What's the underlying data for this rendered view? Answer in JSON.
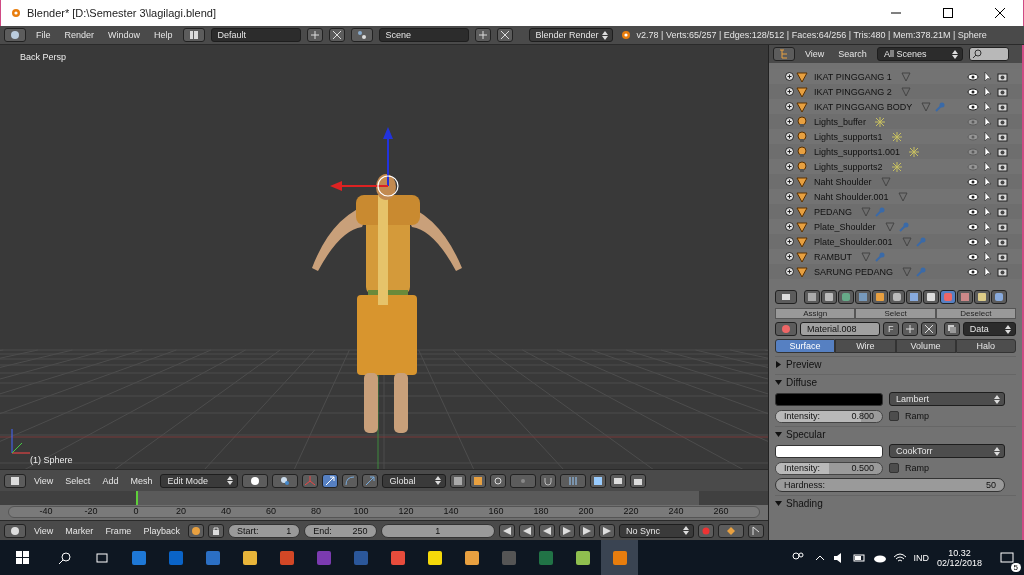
{
  "window": {
    "title": "Blender* [D:\\Semester 3\\lagilagi.blend]"
  },
  "header": {
    "menus": [
      "File",
      "Render",
      "Window",
      "Help"
    ],
    "layout": "Default",
    "scene": "Scene",
    "engine": "Blender Render",
    "stats": "v2.78 | Verts:65/257 | Edges:128/512 | Faces:64/256 | Tris:480 | Mem:378.21M | Sphere"
  },
  "viewport": {
    "view_label": "Back Persp",
    "object_label": "(1) Sphere"
  },
  "view3d_header": {
    "menus": [
      "View",
      "Select",
      "Add",
      "Mesh"
    ],
    "mode": "Edit Mode",
    "orientation": "Global"
  },
  "timeline": {
    "ticks": [
      "-40",
      "-20",
      "0",
      "20",
      "40",
      "60",
      "80",
      "100",
      "120",
      "140",
      "160",
      "180",
      "200",
      "220",
      "240",
      "260"
    ],
    "menus": [
      "View",
      "Marker",
      "Frame",
      "Playback"
    ],
    "start_label": "Start:",
    "start": "1",
    "end_label": "End:",
    "end": "250",
    "current": "1",
    "sync": "No Sync"
  },
  "outliner": {
    "menus": [
      "View",
      "Search"
    ],
    "filter": "All Scenes",
    "items": [
      {
        "name": "IKAT PINGGANG 1",
        "kind": "mesh",
        "modifier": false,
        "visible": true
      },
      {
        "name": "IKAT PINGGANG 2",
        "kind": "mesh",
        "modifier": false,
        "visible": true
      },
      {
        "name": "IKAT PINGGANG BODY",
        "kind": "mesh",
        "modifier": true,
        "visible": true
      },
      {
        "name": "Lights_buffer",
        "kind": "lamp",
        "modifier": false,
        "visible": false
      },
      {
        "name": "Lights_supports1",
        "kind": "lamp",
        "modifier": false,
        "visible": false
      },
      {
        "name": "Lights_supports1.001",
        "kind": "lamp",
        "modifier": false,
        "visible": false
      },
      {
        "name": "Lights_supports2",
        "kind": "lamp",
        "modifier": false,
        "visible": false
      },
      {
        "name": "Naht Shoulder",
        "kind": "mesh",
        "modifier": false,
        "visible": true
      },
      {
        "name": "Naht Shoulder.001",
        "kind": "mesh",
        "modifier": false,
        "visible": true
      },
      {
        "name": "PEDANG",
        "kind": "mesh",
        "modifier": true,
        "visible": true
      },
      {
        "name": "Plate_Shoulder",
        "kind": "mesh",
        "modifier": true,
        "visible": true
      },
      {
        "name": "Plate_Shoulder.001",
        "kind": "mesh",
        "modifier": true,
        "visible": true
      },
      {
        "name": "RAMBUT",
        "kind": "mesh",
        "modifier": true,
        "visible": true
      },
      {
        "name": "SARUNG PEDANG",
        "kind": "mesh",
        "modifier": true,
        "visible": true
      }
    ]
  },
  "properties": {
    "context_tabs": [
      {
        "selected": false
      },
      {
        "selected": false
      },
      {
        "selected": false
      },
      {
        "selected": false
      },
      {
        "selected": false
      },
      {
        "selected": false
      },
      {
        "selected": false
      },
      {
        "selected": false
      },
      {
        "selected": true
      },
      {
        "selected": false
      },
      {
        "selected": false
      },
      {
        "selected": false
      }
    ],
    "slot_buttons": [
      "Assign",
      "Select",
      "Deselect"
    ],
    "material": "Material.008",
    "fake_user": "F",
    "link": "Data",
    "tabs": [
      {
        "label": "Surface",
        "selected": true
      },
      {
        "label": "Wire",
        "selected": false
      },
      {
        "label": "Volume",
        "selected": false
      },
      {
        "label": "Halo",
        "selected": false
      }
    ],
    "panels": [
      {
        "title": "Preview",
        "expanded": false
      },
      {
        "kind": "shader",
        "title": "Diffuse",
        "expanded": true,
        "color": "#000000",
        "shader": "Lambert",
        "intensity_label": "Intensity:",
        "intensity": "0.800",
        "level": 0.8,
        "ramp_label": "Ramp",
        "ramp": false
      },
      {
        "kind": "shader",
        "title": "Specular",
        "expanded": true,
        "color": "#ffffff",
        "shader": "CookTorr",
        "intensity_label": "Intensity:",
        "intensity": "0.500",
        "level": 0.5,
        "ramp_label": "Ramp",
        "ramp": false,
        "hardness_label": "Hardness:",
        "hardness": "50"
      },
      {
        "title": "Shading",
        "expanded": true
      }
    ]
  },
  "taskbar": {
    "apps": [
      {
        "selected": false
      },
      {
        "selected": false
      },
      {
        "selected": false
      },
      {
        "selected": false
      },
      {
        "selected": false
      },
      {
        "selected": false
      },
      {
        "selected": false
      },
      {
        "selected": false
      },
      {
        "selected": false
      },
      {
        "selected": false
      },
      {
        "selected": false
      },
      {
        "selected": false
      },
      {
        "selected": false
      },
      {
        "selected": true
      }
    ],
    "language": "IND",
    "time": "10.32",
    "date": "02/12/2018",
    "notifications": "5"
  }
}
